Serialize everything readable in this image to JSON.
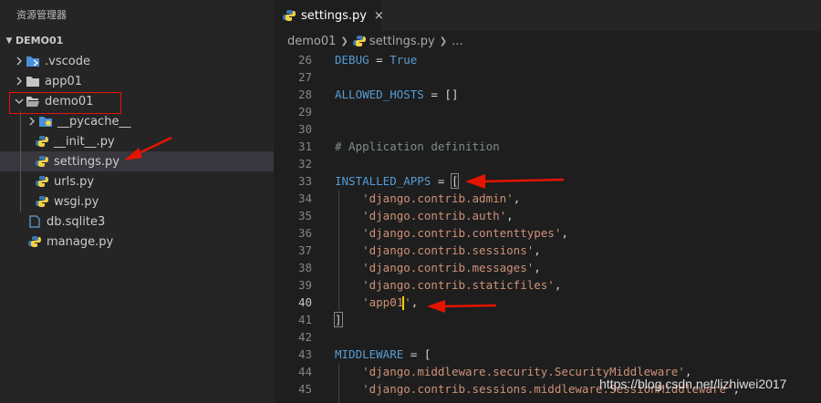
{
  "explorer": {
    "title": "资源管理器",
    "section": "DEMO01",
    "items": [
      {
        "label": ".vscode",
        "icon": "vscode-folder-icon"
      },
      {
        "label": "app01",
        "icon": "folder-icon"
      },
      {
        "label": "demo01",
        "icon": "folder-open-icon"
      },
      {
        "label": "__pycache__",
        "icon": "folder-icon"
      },
      {
        "label": "__init__.py",
        "icon": "python-icon"
      },
      {
        "label": "settings.py",
        "icon": "python-icon"
      },
      {
        "label": "urls.py",
        "icon": "python-icon"
      },
      {
        "label": "wsgi.py",
        "icon": "python-icon"
      },
      {
        "label": "db.sqlite3",
        "icon": "file-icon"
      },
      {
        "label": "manage.py",
        "icon": "python-icon"
      }
    ]
  },
  "editor": {
    "tab_label": "settings.py",
    "close_glyph": "×",
    "breadcrumb": [
      "demo01",
      "settings.py",
      "..."
    ],
    "lines": [
      {
        "num": "26",
        "a": "DEBUG",
        "b": " = ",
        "c": "True"
      },
      {
        "num": "27"
      },
      {
        "num": "28",
        "a": "ALLOWED_HOSTS",
        "b": " = ",
        "c": "[]"
      },
      {
        "num": "29"
      },
      {
        "num": "30"
      },
      {
        "num": "31",
        "comment": "# Application definition"
      },
      {
        "num": "32"
      },
      {
        "num": "33",
        "a": "INSTALLED_APPS",
        "b": " = ",
        "c": "["
      },
      {
        "num": "34",
        "s": "'django.contrib.admin'",
        "p": ","
      },
      {
        "num": "35",
        "s": "'django.contrib.auth'",
        "p": ","
      },
      {
        "num": "36",
        "s": "'django.contrib.contenttypes'",
        "p": ","
      },
      {
        "num": "37",
        "s": "'django.contrib.sessions'",
        "p": ","
      },
      {
        "num": "38",
        "s": "'django.contrib.messages'",
        "p": ","
      },
      {
        "num": "39",
        "s": "'django.contrib.staticfiles'",
        "p": ","
      },
      {
        "num": "40",
        "s1": "'app01",
        "s2": "'",
        "p": ","
      },
      {
        "num": "41",
        "c": "]"
      },
      {
        "num": "42"
      },
      {
        "num": "43",
        "a": "MIDDLEWARE",
        "b": " = ",
        "c": "["
      },
      {
        "num": "44",
        "s": "'django.middleware.security.SecurityMiddleware'",
        "p": ","
      },
      {
        "num": "45",
        "s": "'django.contrib.sessions.middleware.SessionMiddleware'",
        "p": ","
      }
    ]
  },
  "watermark": "https://blog.csdn.net/lizhiwei2017",
  "colors": {
    "annotation_red": "#e51400",
    "identifier": "#569cd6",
    "string": "#ce9178"
  }
}
